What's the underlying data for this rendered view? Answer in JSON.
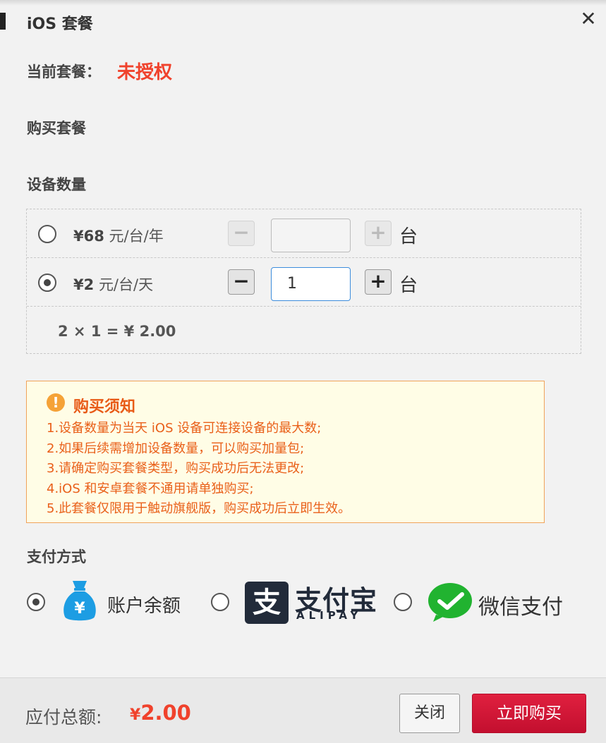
{
  "dialog": {
    "title": "iOS 套餐",
    "close_symbol": "✕"
  },
  "current_plan": {
    "label": "当前套餐：",
    "value": "未授权"
  },
  "purchase": {
    "heading": "购买套餐",
    "device_count_label": "设备数量",
    "plans": [
      {
        "currency": "¥",
        "amount": "68",
        "unit": "元/台/年",
        "selected": false,
        "quantity": "",
        "quantity_unit": "台",
        "enabled": false
      },
      {
        "currency": "¥",
        "amount": "2",
        "unit": "元/台/天",
        "selected": true,
        "quantity": "1",
        "quantity_unit": "台",
        "enabled": true
      }
    ],
    "stepper": {
      "minus": "−",
      "plus": "+"
    },
    "formula": "2 × 1 = ¥ 2.00"
  },
  "notice": {
    "icon": "!",
    "title": "购买须知",
    "items": [
      "1.设备数量为当天 iOS 设备可连接设备的最大数;",
      "2.如果后续需增加设备数量，可以购买加量包;",
      "3.请确定购买套餐类型，购买成功后无法更改;",
      "4.iOS 和安卓套餐不通用请单独购买;",
      "5.此套餐仅限用于触动旗舰版，购买成功后立即生效。"
    ]
  },
  "payment": {
    "label": "支付方式",
    "methods": [
      {
        "name": "账户余额",
        "selected": true,
        "icon": "money-bag-icon",
        "icon_char": "¥",
        "color": "#1d9de3"
      },
      {
        "name": "支付宝",
        "sub": "ALIPAY",
        "selected": false,
        "icon": "alipay-icon",
        "icon_char": "支",
        "color": "#222b3a"
      },
      {
        "name": "微信支付",
        "selected": false,
        "icon": "wechat-pay-icon",
        "color": "#21b330"
      }
    ]
  },
  "footer": {
    "total_label": "应付总额:",
    "total_currency": "¥",
    "total_value": "2.00",
    "close_button": "关闭",
    "buy_button": "立即购买"
  },
  "colors": {
    "accent_red": "#f0422c",
    "buy_button": "#d4173a",
    "notice_orange": "#e9601a"
  }
}
